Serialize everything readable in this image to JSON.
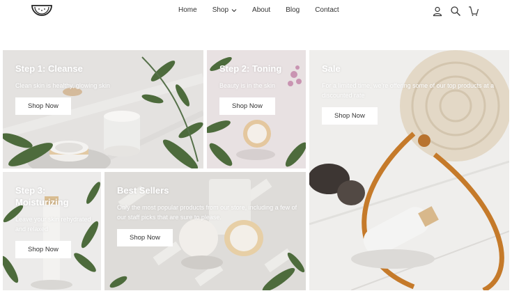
{
  "header": {
    "logo": "watermelon-logo",
    "nav": [
      {
        "label": "Home"
      },
      {
        "label": "Shop",
        "has_dropdown": true
      },
      {
        "label": "About"
      },
      {
        "label": "Blog"
      },
      {
        "label": "Contact"
      }
    ],
    "icons": [
      "account-icon",
      "search-icon",
      "cart-icon"
    ]
  },
  "tiles": [
    {
      "title": "Step 1: Cleanse",
      "text": "Clean skin is healthy, glowing skin",
      "button": "Shop Now"
    },
    {
      "title": "Step 2: Toning",
      "text": "Beauty is in the skin",
      "button": "Shop Now"
    },
    {
      "title": "Sale",
      "text": "For a limited time, we're offering some of our top products at a discounted rate",
      "button": "Shop Now"
    },
    {
      "title": "Step 3: Moisturizing",
      "text": "Leave your skin rehydrated and relaxed",
      "button": "Shop Now"
    },
    {
      "title": "Best Sellers",
      "text": "Only the most popular products from our store, including a few of our staff picks that are sure to please.",
      "button": "Shop Now"
    }
  ],
  "colors": {
    "text": "#333333",
    "button_bg": "#ffffff",
    "overlay_text": "#ffffff"
  }
}
